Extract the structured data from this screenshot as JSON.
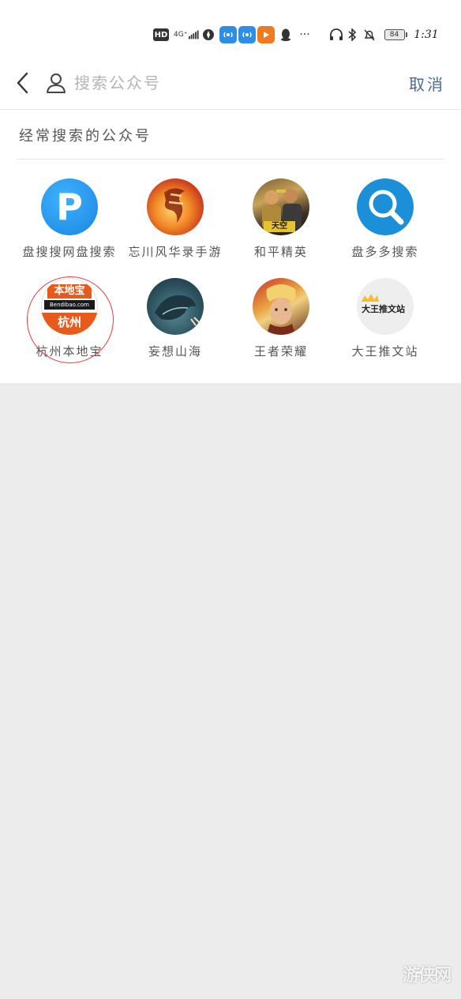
{
  "status_bar": {
    "hd": "HD",
    "network": "4G⁺",
    "more": "···",
    "battery": "84",
    "time": "1:31"
  },
  "search": {
    "placeholder": "搜索公众号",
    "value": "",
    "cancel_label": "取消"
  },
  "section_title": "经常搜索的公众号",
  "accounts": [
    {
      "name": "盘搜搜网盘搜索",
      "avatar_icon": "blue-p-logo",
      "avatar_text": "P"
    },
    {
      "name": "忘川风华录手游",
      "avatar_icon": "fire-calligraphy-art"
    },
    {
      "name": "和平精英",
      "avatar_icon": "game-soldiers-art",
      "avatar_text": "天空"
    },
    {
      "name": "盘多多搜索",
      "avatar_icon": "magnifier-icon"
    },
    {
      "name": "杭州本地宝",
      "avatar_icon": "bendibao-logo",
      "avatar_text_top": "本地宝",
      "avatar_text_mid": "Bendibao.com",
      "avatar_text_bottom": "杭州"
    },
    {
      "name": "妄想山海",
      "avatar_icon": "whale-art"
    },
    {
      "name": "王者荣耀",
      "avatar_icon": "hero-portrait-art"
    },
    {
      "name": "大王推文站",
      "avatar_icon": "crown-logo",
      "avatar_text": "大王推文站"
    }
  ],
  "watermark": "游侠网",
  "colors": {
    "accent": "#4a6a9a",
    "background": "#ececec",
    "panel": "#ffffff"
  }
}
